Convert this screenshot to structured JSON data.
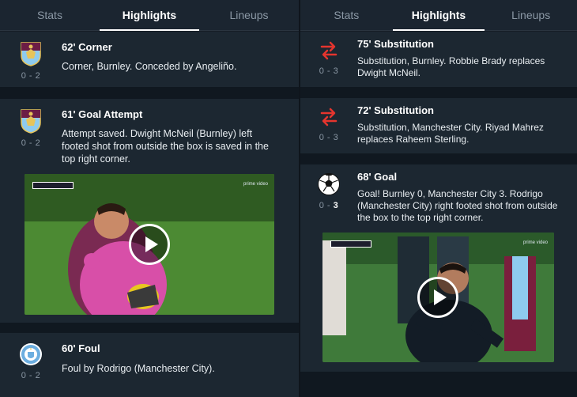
{
  "tabs": [
    "Stats",
    "Highlights",
    "Lineups"
  ],
  "active_tab": "Highlights",
  "left_events": [
    {
      "title": "62' Corner",
      "description": "Corner,  Burnley. Conceded by Angeliño.",
      "score": "0 - 2",
      "icon": "burnley-crest-icon"
    },
    {
      "title": "61' Goal Attempt",
      "description": "Attempt saved. Dwight McNeil (Burnley) left footed shot from outside the box is saved in the top right corner.",
      "score": "0 - 2",
      "icon": "burnley-crest-icon",
      "video_brand": "prime video"
    },
    {
      "title": "60' Foul",
      "description": "Foul by Rodrigo (Manchester City).",
      "score": "0 - 2",
      "icon": "manchester-city-crest-icon"
    }
  ],
  "right_events": [
    {
      "title": "75' Substitution",
      "description": "Substitution, Burnley. Robbie Brady replaces Dwight McNeil.",
      "score": "0 - 3",
      "icon": "substitution-arrows-icon"
    },
    {
      "title": "72' Substitution",
      "description": "Substitution, Manchester City. Riyad Mahrez replaces Raheem Sterling.",
      "score": "0 - 3",
      "icon": "substitution-arrows-icon"
    },
    {
      "title": "68' Goal",
      "description": "Goal!  Burnley 0, Manchester City 3. Rodrigo (Manchester City) right footed shot from outside the box to the top right corner.",
      "score_home": "0",
      "score_sep": " - ",
      "score_away": "3",
      "icon": "football-icon",
      "video_brand": "prime video"
    }
  ],
  "colors": {
    "accent_red": "#e4352e",
    "burnley_claret": "#6c1d45",
    "burnley_blue": "#8ecbef",
    "city_blue": "#6caee0"
  }
}
